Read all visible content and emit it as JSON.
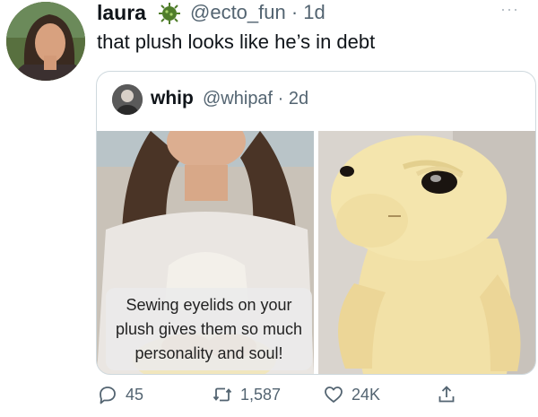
{
  "tweet": {
    "author_name": "laura",
    "author_handle": "@ecto_fun · 1d",
    "text": "that plush looks like he’s in debt",
    "more_label": "···"
  },
  "quote": {
    "author_name": "whip",
    "author_handle": "@whipaf · 2d",
    "caption": "Sewing eyelids on your plush gives them so much personality and soul!"
  },
  "actions": {
    "replies": "45",
    "retweets": "1,587",
    "likes": "24K"
  },
  "colors": {
    "text": "#0f1419",
    "secondary": "#536471",
    "border": "#cfd9de"
  }
}
